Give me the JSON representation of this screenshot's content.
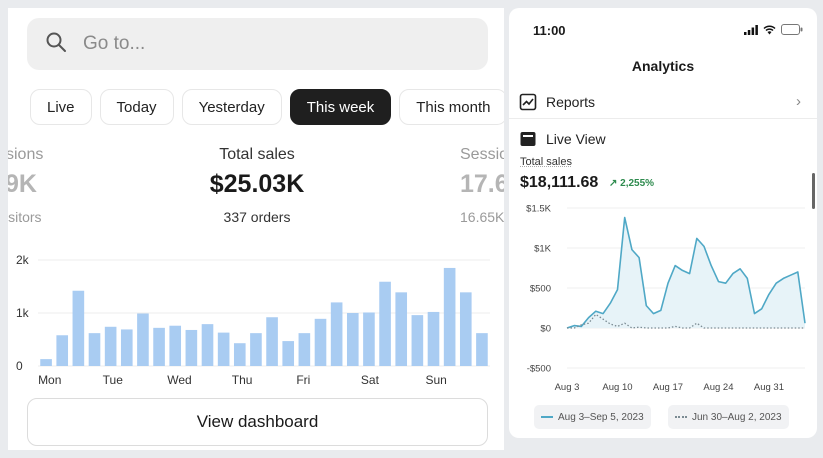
{
  "left": {
    "search": {
      "placeholder": "Go to...",
      "icon": "search-icon"
    },
    "tabs": [
      {
        "label": "Live",
        "active": false
      },
      {
        "label": "Today",
        "active": false
      },
      {
        "label": "Yesterday",
        "active": false
      },
      {
        "label": "This week",
        "active": true
      },
      {
        "label": "This month",
        "active": false
      }
    ],
    "metrics": {
      "prev": {
        "label": "ssions",
        "value": ".9K",
        "sub": "visitors"
      },
      "main": {
        "label": "Total sales",
        "value": "$25.03K",
        "sub": "337 orders"
      },
      "next": {
        "label": "Sessio",
        "value": "17.6",
        "sub": "16.65K"
      }
    },
    "dashboard_button": "View dashboard"
  },
  "chart_data": [
    {
      "type": "bar",
      "title": "",
      "xlabel": "",
      "ylabel": "",
      "ylim": [
        0,
        2000
      ],
      "yticks": [
        "0",
        "1k",
        "2k"
      ],
      "x_labels": [
        "Mon",
        "Tue",
        "Wed",
        "Thu",
        "Fri",
        "Sat",
        "Sun"
      ],
      "bars_per_label": 4,
      "color": "#a9ccf2",
      "values": [
        130,
        580,
        1420,
        620,
        740,
        690,
        990,
        720,
        760,
        680,
        790,
        630,
        430,
        620,
        920,
        470,
        620,
        890,
        1200,
        1000,
        1010,
        1590,
        1390,
        960,
        1020,
        1850,
        1390,
        620
      ]
    },
    {
      "type": "line",
      "title": "",
      "xlabel": "",
      "ylabel": "",
      "ylim": [
        -500,
        1500
      ],
      "yticks": [
        "$1.5K",
        "$1K",
        "$500",
        "$0",
        "-$500"
      ],
      "xticks": [
        "Aug 3",
        "Aug 10",
        "Aug 17",
        "Aug 24",
        "Aug 31"
      ],
      "series": [
        {
          "name": "Aug 3–Sep 5, 2023",
          "color": "#4fa8c6",
          "style": "solid",
          "values": [
            0,
            30,
            20,
            130,
            210,
            180,
            310,
            480,
            1380,
            980,
            880,
            280,
            180,
            220,
            560,
            780,
            720,
            680,
            1120,
            1020,
            780,
            580,
            560,
            680,
            740,
            620,
            180,
            240,
            420,
            560,
            620,
            660,
            700,
            60
          ]
        },
        {
          "name": "Jun 30–Aug 2, 2023",
          "color": "#7b8b93",
          "style": "dotted",
          "values": [
            0,
            0,
            40,
            60,
            170,
            110,
            50,
            20,
            60,
            0,
            10,
            0,
            0,
            0,
            0,
            20,
            0,
            0,
            60,
            0,
            0,
            0,
            0,
            0,
            0,
            0,
            0,
            0,
            0,
            0,
            0,
            0,
            0,
            0
          ]
        }
      ]
    }
  ],
  "right": {
    "status_time": "11:00",
    "title": "Analytics",
    "reports_label": "Reports",
    "live_label": "Live View",
    "total_sales_label": "Total sales",
    "total_sales_value": "$18,111.68",
    "change": "↗ 2,255%",
    "legend": [
      "Aug 3–Sep 5, 2023",
      "Jun 30–Aug 2, 2023"
    ]
  }
}
